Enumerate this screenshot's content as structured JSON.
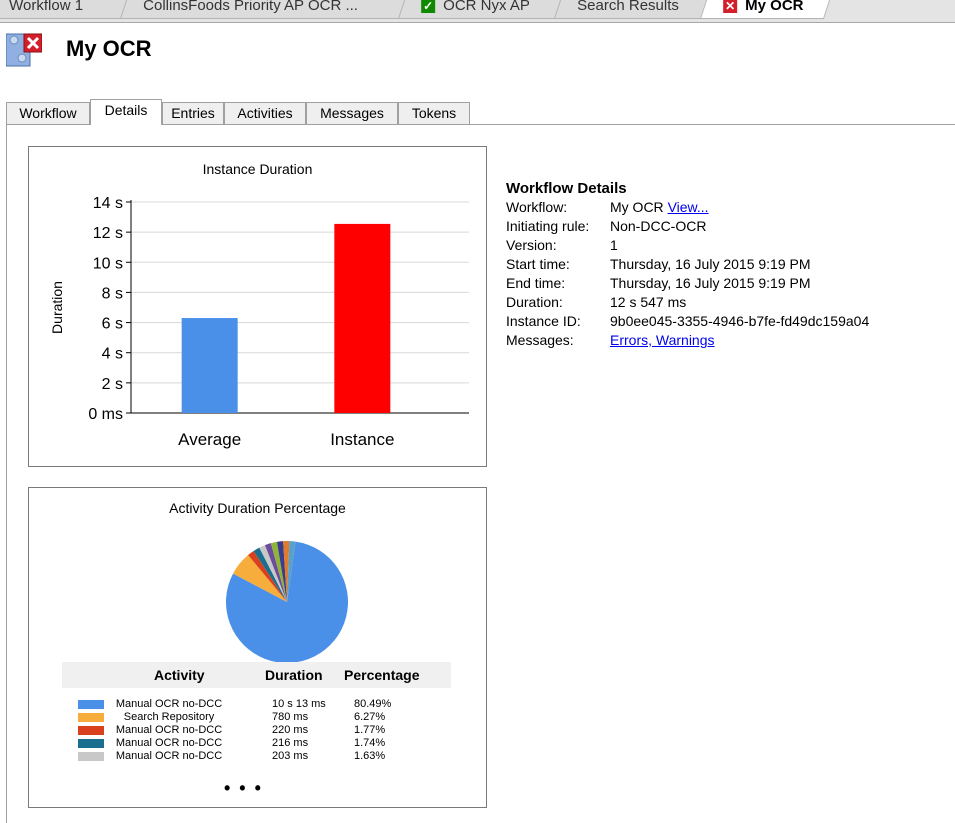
{
  "doc_tabs": [
    {
      "label": "Workflow 1",
      "icon": null,
      "active": false
    },
    {
      "label": "CollinsFoods Priority AP OCR ...",
      "icon": null,
      "active": false
    },
    {
      "label": "OCR Nyx AP",
      "icon": "check-icon",
      "active": false
    },
    {
      "label": "Search Results",
      "icon": null,
      "active": false
    },
    {
      "label": "My OCR",
      "icon": "close-icon",
      "active": true
    }
  ],
  "header": {
    "title": "My OCR"
  },
  "sub_tabs": [
    "Workflow",
    "Details",
    "Entries",
    "Activities",
    "Messages",
    "Tokens"
  ],
  "active_sub_tab": "Details",
  "details": {
    "title": "Workflow Details",
    "rows": [
      {
        "label": "Workflow:",
        "value": "My OCR",
        "link": "View..."
      },
      {
        "label": "Initiating rule:",
        "value": "Non-DCC-OCR"
      },
      {
        "label": "Version:",
        "value": "1"
      },
      {
        "label": "Start time:",
        "value": "Thursday, 16 July 2015 9:19 PM"
      },
      {
        "label": "End time:",
        "value": "Thursday, 16 July 2015 9:19 PM"
      },
      {
        "label": "Duration:",
        "value": "12 s 547 ms"
      },
      {
        "label": "Instance ID:",
        "value": "9b0ee045-3355-4946-b7fe-fd49dc159a04"
      },
      {
        "label": "Messages:",
        "value": "",
        "link": "Errors, Warnings"
      }
    ]
  },
  "chart_data": [
    {
      "type": "bar",
      "title": "Instance Duration",
      "ylabel": "Duration",
      "categories": [
        "Average",
        "Instance"
      ],
      "values": [
        6.3,
        12.547
      ],
      "colors": [
        "#4a90e8",
        "#ff0000"
      ],
      "ylim": [
        0,
        14
      ],
      "yticks": [
        {
          "value": 14,
          "label": "14 s"
        },
        {
          "value": 12,
          "label": "12 s"
        },
        {
          "value": 10,
          "label": "10 s"
        },
        {
          "value": 8,
          "label": "8 s"
        },
        {
          "value": 6,
          "label": "6 s"
        },
        {
          "value": 4,
          "label": "4 s"
        },
        {
          "value": 2,
          "label": "2 s"
        },
        {
          "value": 0,
          "label": "0 ms"
        }
      ],
      "grid": true
    },
    {
      "type": "pie",
      "title": "Activity Duration Percentage",
      "table_headers": [
        "Activity",
        "Duration",
        "Percentage"
      ],
      "slices": [
        {
          "activity": "Manual OCR no-DCC",
          "duration": "10 s 13 ms",
          "percentage": "80.49%",
          "value": 80.49,
          "color": "#4a90e8"
        },
        {
          "activity": "Search Repository",
          "duration": "780 ms",
          "percentage": "6.27%",
          "value": 6.27,
          "color": "#f6ad3c"
        },
        {
          "activity": "Manual OCR no-DCC",
          "duration": "220 ms",
          "percentage": "1.77%",
          "value": 1.77,
          "color": "#d9411e"
        },
        {
          "activity": "Manual OCR no-DCC",
          "duration": "216 ms",
          "percentage": "1.74%",
          "value": 1.74,
          "color": "#1a6e8e"
        },
        {
          "activity": "Manual OCR no-DCC",
          "duration": "203 ms",
          "percentage": "1.63%",
          "value": 1.63,
          "color": "#c8c8c8"
        }
      ],
      "extra_slice_colors": [
        "#6d4c9b",
        "#8fb43a",
        "#3c3c8c",
        "#e07a2c",
        "#5aa0c8"
      ],
      "more_indicator": "• • •"
    }
  ]
}
